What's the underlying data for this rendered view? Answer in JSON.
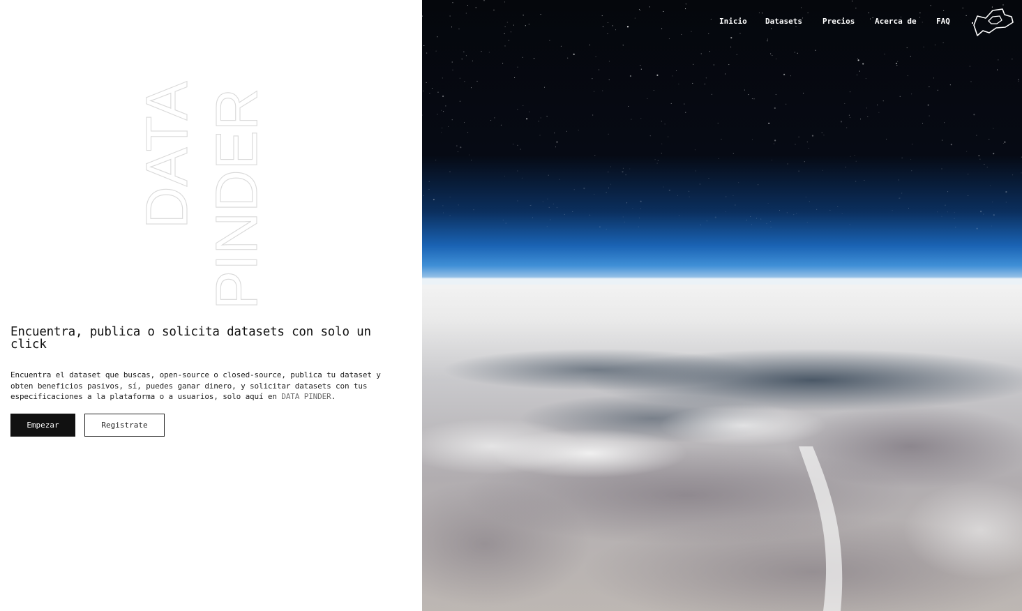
{
  "brand": {
    "vertical_line1": "DATA",
    "vertical_line2": "PINDER",
    "logo_icon": "map-outline-icon"
  },
  "nav": {
    "items": [
      {
        "label": "Inicio"
      },
      {
        "label": "Datasets"
      },
      {
        "label": "Precios"
      },
      {
        "label": "Acerca de"
      },
      {
        "label": "FAQ"
      }
    ]
  },
  "hero": {
    "title": "Encuentra, publica o solicita datasets con solo un click",
    "description": "Encuentra el dataset que buscas, open-source o closed-source, publica tu dataset y obten beneficios pasivos, sí, puedes ganar dinero, y solicitar datasets con tus especificaciones a la plataforma o a usuarios, solo aquí en ",
    "description_brand": "DATA PINDER",
    "description_end": ".",
    "primary_button": "Empezar",
    "secondary_button": "Registrate"
  },
  "colors": {
    "primary_button_bg": "#111111",
    "text": "#111111",
    "brand_outline": "#d9d9d9",
    "sky_top": "#05070c",
    "atmosphere_blue": "#1d6fc4"
  }
}
